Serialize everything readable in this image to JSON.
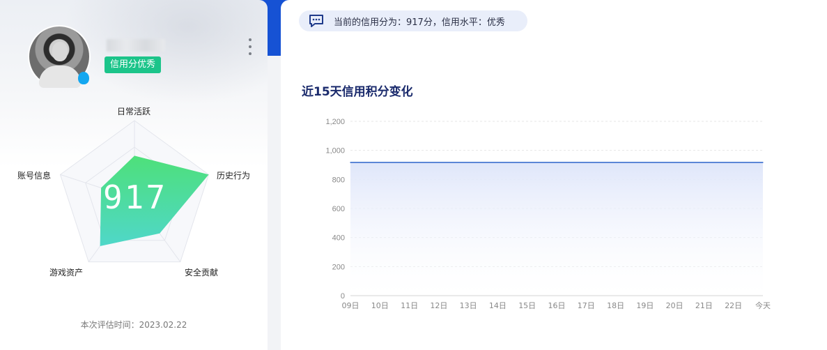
{
  "profile": {
    "credit_badge": "信用分优秀",
    "avatar_caption": ""
  },
  "radar": {
    "score": "917",
    "labels": {
      "top": "日常活跃",
      "right": "历史行为",
      "bottom_right": "安全贡献",
      "bottom_left": "游戏资产",
      "left": "账号信息"
    },
    "values": {
      "daily_active": 0.55,
      "history": 1.0,
      "security": 0.55,
      "game_assets": 0.75,
      "account_info": 0.45
    },
    "eval_time": "本次评估时间：2023.02.22"
  },
  "notice": {
    "text": "当前的信用分为：917分，信用水平：优秀"
  },
  "chart_data": {
    "type": "area",
    "title": "近15天信用积分变化",
    "categories": [
      "09日",
      "10日",
      "11日",
      "12日",
      "13日",
      "14日",
      "15日",
      "16日",
      "17日",
      "18日",
      "19日",
      "20日",
      "21日",
      "22日",
      "今天"
    ],
    "series": [
      {
        "values": [
          917,
          917,
          917,
          917,
          917,
          917,
          917,
          917,
          917,
          917,
          917,
          917,
          917,
          917,
          917
        ]
      }
    ],
    "ylim": [
      0,
      1200
    ],
    "yticks": [
      "0",
      "200",
      "400",
      "600",
      "800",
      "1,000",
      "1,200"
    ],
    "grid": true,
    "colors": {
      "line": "#5b86d6",
      "fill_top": "#dfe6fa",
      "fill_bottom": "#ffffff",
      "axis_text": "#888888",
      "grid": "#e6e6e6"
    }
  }
}
